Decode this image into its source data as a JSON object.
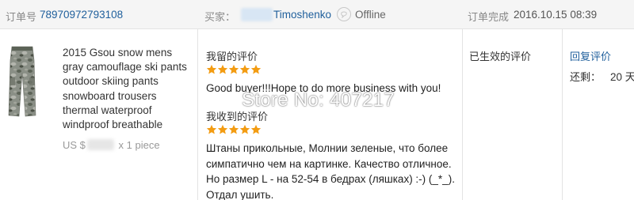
{
  "header": {
    "order_id_label": "订单号",
    "order_id_value": "78970972793108",
    "buyer_label": "买家：",
    "buyer_name": "Timoshenko",
    "buyer_status": "Offline",
    "completed_label": "订单完成",
    "completed_date": "2016.10.15 08:39"
  },
  "product": {
    "title": "2015 Gsou snow mens gray camouflage ski pants outdoor skiing pants snowboard trousers thermal waterproof windproof breathable",
    "price_prefix": "US $",
    "quantity": "x 1 piece"
  },
  "feedback": {
    "given_heading": "我留的评价",
    "given_stars": 5,
    "given_text": "Good buyer!!!Hope to do more business with you!",
    "received_heading": "我收到的评价",
    "received_stars": 5,
    "received_text": "Штаны прикольные, Молнии зеленые, что более симпатично чем на картинке. Качество отличное. Но размер L - на 52-54 в бедрах (ляшках) :-) (_*_). Отдал ушить."
  },
  "watermark": "Store No: 407217",
  "status": {
    "text": "已生效的评价"
  },
  "actions": {
    "reply_label": "回复评价",
    "remaining_label": "还剩：",
    "remaining_value": "20 天"
  },
  "colors": {
    "link": "#1f5f9c",
    "star": "#f39c12",
    "header_bg": "#f5f5f5"
  }
}
